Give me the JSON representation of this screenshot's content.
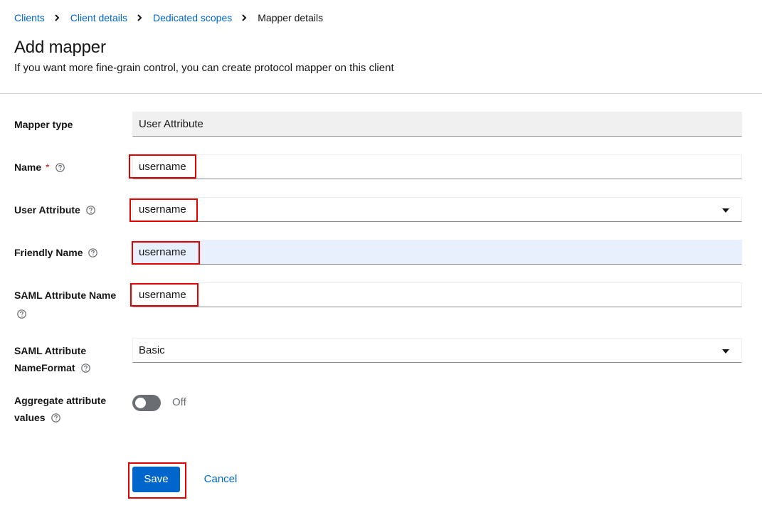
{
  "breadcrumb": {
    "items": [
      "Clients",
      "Client details",
      "Dedicated scopes"
    ],
    "current": "Mapper details"
  },
  "header": {
    "title": "Add mapper",
    "subtitle": "If you want more fine-grain control, you can create protocol mapper on this client"
  },
  "form": {
    "mapper_type": {
      "label": "Mapper type",
      "value": "User Attribute"
    },
    "name": {
      "label": "Name",
      "required_mark": "*",
      "value": "username"
    },
    "user_attribute": {
      "label": "User Attribute",
      "value": "username"
    },
    "friendly_name": {
      "label": "Friendly Name",
      "value": "username"
    },
    "saml_attribute_name": {
      "label": "SAML Attribute Name",
      "value": "username"
    },
    "saml_attribute_nameformat": {
      "label_line1": "SAML Attribute",
      "label_line2": "NameFormat",
      "value": "Basic"
    },
    "aggregate": {
      "label_line1": "Aggregate attribute",
      "label_line2": "values",
      "state": "Off"
    }
  },
  "actions": {
    "save_label": "Save",
    "cancel_label": "Cancel"
  },
  "colors": {
    "link": "#0066cc",
    "primary": "#0066cc",
    "highlight": "#e00000",
    "required": "#c9190b",
    "toggle_off": "#6a6e73"
  },
  "icons": {
    "breadcrumb_separator": "chevron-right-icon",
    "help": "question-circle-icon",
    "dropdown": "caret-down-icon"
  }
}
